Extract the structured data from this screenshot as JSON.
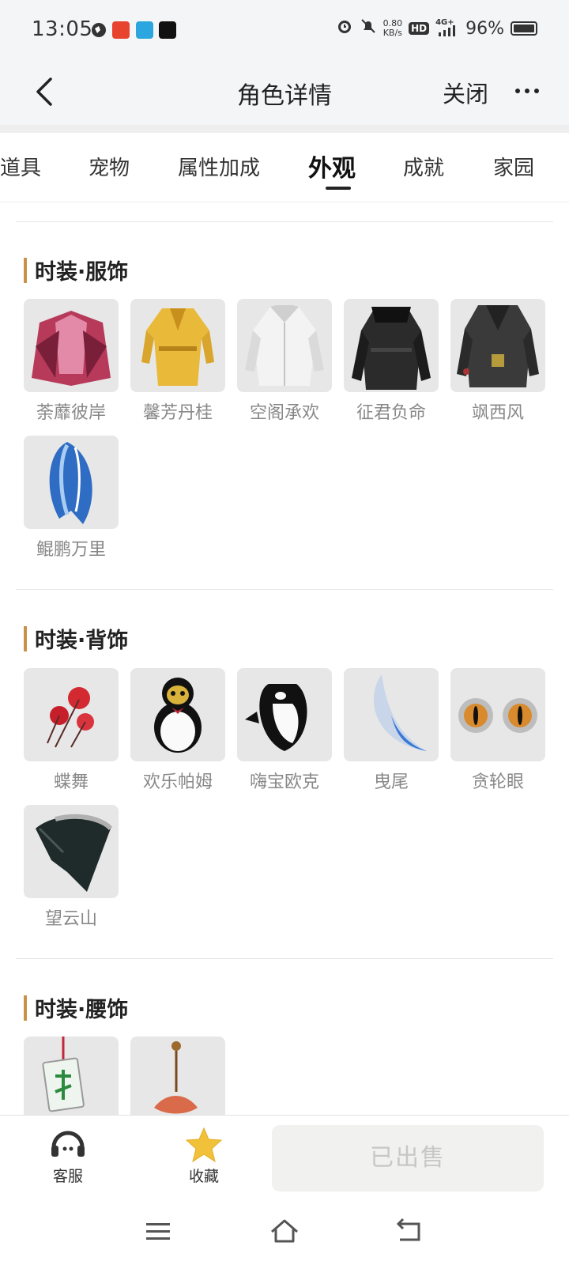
{
  "status_bar": {
    "time": "13:05",
    "speed_value": "0.80",
    "speed_unit": "KB/s",
    "hd": "HD",
    "network": "4G+",
    "battery": "96%"
  },
  "nav": {
    "title": "角色详情",
    "close_label": "关闭"
  },
  "tabs": [
    {
      "label": "道具"
    },
    {
      "label": "宠物"
    },
    {
      "label": "属性加成"
    },
    {
      "label": "外观",
      "active": true
    },
    {
      "label": "成就"
    },
    {
      "label": "家园"
    }
  ],
  "sections": [
    {
      "title": "时装·服饰",
      "items": [
        {
          "name": "荼蘼彼岸"
        },
        {
          "name": "馨芳丹桂"
        },
        {
          "name": "空阁承欢"
        },
        {
          "name": "征君负命"
        },
        {
          "name": "飒西风"
        },
        {
          "name": "鲲鹏万里"
        }
      ]
    },
    {
      "title": "时装·背饰",
      "items": [
        {
          "name": "蝶舞"
        },
        {
          "name": "欢乐帕姆"
        },
        {
          "name": "嗨宝欧克"
        },
        {
          "name": "曳尾"
        },
        {
          "name": "贪轮眼"
        },
        {
          "name": "望云山"
        }
      ]
    },
    {
      "title": "时装·腰饰",
      "items": [
        {
          "name": ""
        },
        {
          "name": ""
        }
      ]
    }
  ],
  "bottom_bar": {
    "service_label": "客服",
    "favorite_label": "收藏",
    "sold_label": "已出售"
  },
  "colors": {
    "accent_bar": "#c9924a",
    "star": "#f2c13a",
    "sold_bg": "#f1f1ef"
  }
}
